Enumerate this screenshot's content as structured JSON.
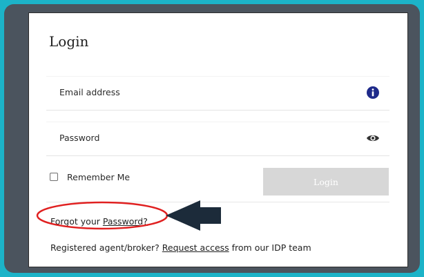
{
  "login": {
    "title": "Login",
    "email_label": "Email address",
    "password_label": "Password",
    "remember_label": "Remember Me",
    "login_button": "Login",
    "forgot_prefix": "Forgot your ",
    "forgot_link": "Password?",
    "register_prefix": "Registered agent/broker? ",
    "register_link": "Request access",
    "register_suffix": " from our IDP team"
  },
  "icons": {
    "email_icon": "info-icon",
    "password_icon": "eye-icon"
  },
  "colors": {
    "background_accent": "#1cb3c8",
    "frame": "#4b545e",
    "info_icon": "#1e2a8a",
    "button_disabled": "#d7d7d7",
    "annotation_circle": "#e02020",
    "annotation_arrow": "#1c2b3a"
  }
}
